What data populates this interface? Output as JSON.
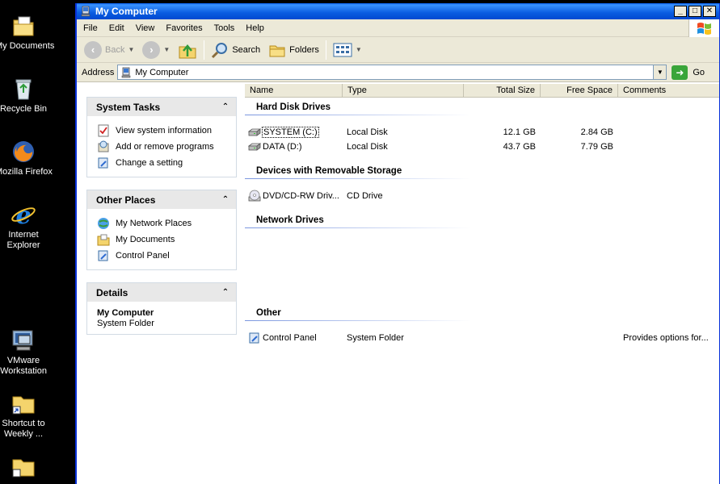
{
  "desktop": {
    "icons": [
      {
        "label": "My Documents",
        "icon": "my-documents-icon"
      },
      {
        "label": "Recycle Bin",
        "icon": "recycle-bin-icon"
      },
      {
        "label": "Mozilla Firefox",
        "icon": "firefox-icon"
      },
      {
        "label_line1": "Internet",
        "label_line2": "Explorer",
        "icon": "internet-explorer-icon"
      },
      {
        "label_line1": "VMware",
        "label_line2": "Workstation",
        "icon": "vmware-icon"
      },
      {
        "label_line1": "Shortcut to",
        "label_line2": "Weekly ...",
        "icon": "folder-shortcut-icon"
      }
    ]
  },
  "window": {
    "title": "My Computer",
    "buttons": {
      "minimize": "_",
      "maximize": "□",
      "close": "✕"
    }
  },
  "menu": [
    "File",
    "Edit",
    "View",
    "Favorites",
    "Tools",
    "Help"
  ],
  "toolbar": {
    "back": "Back",
    "search": "Search",
    "folders": "Folders"
  },
  "address": {
    "label": "Address",
    "value": "My Computer",
    "go": "Go"
  },
  "tasks": {
    "system_tasks": {
      "title": "System Tasks",
      "items": [
        "View system information",
        "Add or remove programs",
        "Change a setting"
      ]
    },
    "other_places": {
      "title": "Other Places",
      "items": [
        "My Network Places",
        "My Documents",
        "Control Panel"
      ]
    },
    "details": {
      "title": "Details",
      "name": "My Computer",
      "subtitle": "System Folder"
    }
  },
  "columns": [
    "Name",
    "Type",
    "Total Size",
    "Free Space",
    "Comments"
  ],
  "groups": {
    "hard_disks": {
      "title": "Hard Disk Drives",
      "rows": [
        {
          "name": "SYSTEM (C:)",
          "type": "Local Disk",
          "total": "12.1 GB",
          "free": "2.84 GB"
        },
        {
          "name": "DATA (D:)",
          "type": "Local Disk",
          "total": "43.7 GB",
          "free": "7.79 GB"
        }
      ]
    },
    "removable": {
      "title": "Devices with Removable Storage",
      "rows": [
        {
          "name": "DVD/CD-RW Driv...",
          "type": "CD Drive"
        }
      ]
    },
    "network": {
      "title": "Network Drives"
    },
    "other": {
      "title": "Other",
      "rows": [
        {
          "name": "Control Panel",
          "type": "System Folder",
          "comment": "Provides options for..."
        }
      ]
    }
  }
}
